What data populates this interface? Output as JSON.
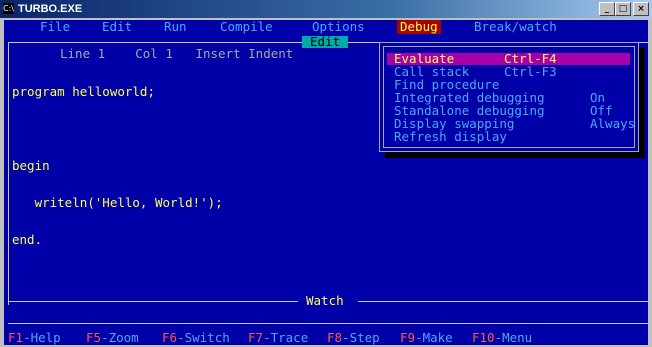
{
  "window": {
    "title": "TURBO.EXE",
    "icon_label": "C:\\",
    "buttons": {
      "minimize": "_",
      "maximize": "□",
      "close": "×"
    }
  },
  "menubar": {
    "items": [
      "File",
      "Edit",
      "Run",
      "Compile",
      "Options",
      "Debug",
      "Break/watch"
    ],
    "active": "Debug"
  },
  "editor": {
    "title": "Edit",
    "status": "Line 1    Col 1   Insert Indent",
    "code": [
      "program helloworld;",
      "",
      "begin",
      "   writeln('Hello, World!');",
      "end."
    ]
  },
  "watch": {
    "title": "Watch"
  },
  "debug_menu": {
    "items": [
      {
        "label": "Evaluate",
        "shortcut": "Ctrl-F4",
        "value": ""
      },
      {
        "label": "Call stack",
        "shortcut": "Ctrl-F3",
        "value": ""
      },
      {
        "label": "Find procedure",
        "shortcut": "",
        "value": ""
      },
      {
        "label": "Integrated debugging",
        "shortcut": "",
        "value": "On"
      },
      {
        "label": "Standalone debugging",
        "shortcut": "",
        "value": "Off"
      },
      {
        "label": "Display swapping",
        "shortcut": "",
        "value": "Always"
      },
      {
        "label": "Refresh display",
        "shortcut": "",
        "value": ""
      }
    ]
  },
  "function_keys": [
    {
      "key": "F1",
      "label": "-Help"
    },
    {
      "key": "F5",
      "label": "-Zoom"
    },
    {
      "key": "F6",
      "label": "-Switch"
    },
    {
      "key": "F7",
      "label": "-Trace"
    },
    {
      "key": "F8",
      "label": "-Step"
    },
    {
      "key": "F9",
      "label": "-Make"
    },
    {
      "key": "F10",
      "label": "-Menu"
    }
  ],
  "colors": {
    "screen_bg": "#0000a8",
    "menu_text": "#4aa8ff",
    "active_menu_bg": "#aa0000",
    "highlight_bg": "#a800a8",
    "code_text": "#ffff55",
    "fkey_key": "#ff5555"
  }
}
